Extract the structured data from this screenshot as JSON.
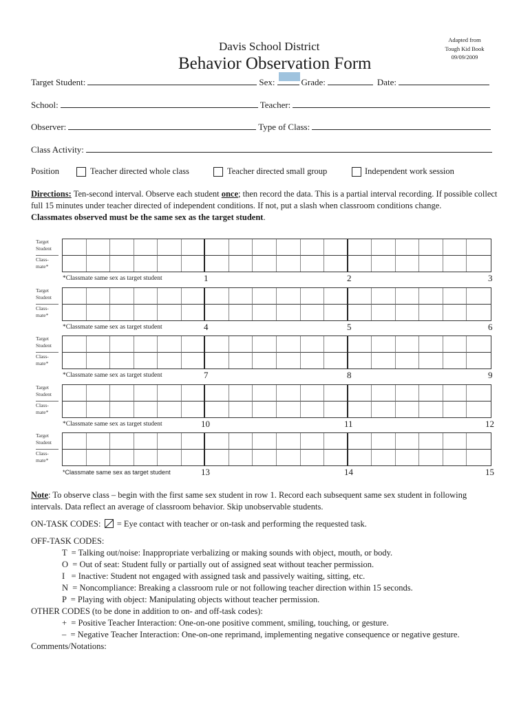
{
  "header": {
    "district": "Davis School District",
    "title": "Behavior Observation Form",
    "adapted": [
      "Adapted from",
      "Tough Kid Book",
      "09/09/2009"
    ]
  },
  "fields": {
    "target_student": {
      "label": "Target Student:",
      "value": ""
    },
    "sex": {
      "label": "Sex:",
      "value": ""
    },
    "grade": {
      "label": "Grade:",
      "value": ""
    },
    "date": {
      "label": "Date:",
      "value": ""
    },
    "school": {
      "label": "School:",
      "value": ""
    },
    "teacher": {
      "label": "Teacher:",
      "value": ""
    },
    "observer": {
      "label": "Observer:",
      "value": ""
    },
    "type_of_class": {
      "label": "Type of Class:",
      "value": ""
    },
    "class_activity": {
      "label": "Class Activity:",
      "value": ""
    }
  },
  "position": {
    "label": "Position",
    "options": [
      {
        "label": "Teacher directed whole class",
        "checked": false
      },
      {
        "label": "Teacher directed small group",
        "checked": false
      },
      {
        "label": "Independent work session",
        "checked": false
      }
    ]
  },
  "directions": {
    "heading": "Directions:",
    "text1": " Ten-second interval. Observe each student ",
    "emph": "once",
    "text2": "; then record the data. This is a partial interval recording. If possible collect full 15 minutes under teacher directed of independent conditions. If not, put a slash when classroom conditions change.",
    "bold": "Classmates observed must be the same sex as the target student",
    "end": "."
  },
  "grid": {
    "row_labels": {
      "target": [
        "Target",
        "Student"
      ],
      "classmate": [
        "Class-",
        "mate*"
      ]
    },
    "footnote": "*Classmate same sex as target student",
    "blocks": [
      {
        "minutes": [
          "1",
          "2",
          "3"
        ]
      },
      {
        "minutes": [
          "4",
          "5",
          "6"
        ]
      },
      {
        "minutes": [
          "7",
          "8",
          "9"
        ]
      },
      {
        "minutes": [
          "10",
          "11",
          "12"
        ]
      },
      {
        "minutes": [
          "13",
          "14",
          "15"
        ]
      }
    ]
  },
  "note": {
    "heading": "Note",
    "text": ": To observe class – begin with the first same sex student in row 1. Record each subsequent same sex student in following intervals. Data reflect an average of classroom behavior. Skip unobservable students."
  },
  "codes": {
    "on_task_label": "ON-TASK CODES:",
    "on_task_desc": "= Eye contact with teacher or on-task and performing the requested task.",
    "off_task_label": "OFF-TASK CODES:",
    "off_task": [
      "T  = Talking out/noise: Inappropriate verbalizing or making sounds with object, mouth, or body.",
      "O  = Out of seat: Student fully or partially out of assigned seat without teacher permission.",
      "I   = Inactive: Student not engaged with assigned task and passively waiting, sitting, etc.",
      "N  = Noncompliance: Breaking a classroom rule or not following teacher direction within 15 seconds.",
      "P  = Playing with object: Manipulating objects without teacher permission."
    ],
    "other_label": "OTHER CODES (to be done in addition to on- and off-task codes):",
    "other": [
      "+  = Positive Teacher Interaction: One-on-one positive comment, smiling, touching, or gesture.",
      "–  = Negative Teacher Interaction: One-on-one reprimand, implementing negative consequence or negative gesture."
    ],
    "comments_label": "Comments/Notations:"
  }
}
